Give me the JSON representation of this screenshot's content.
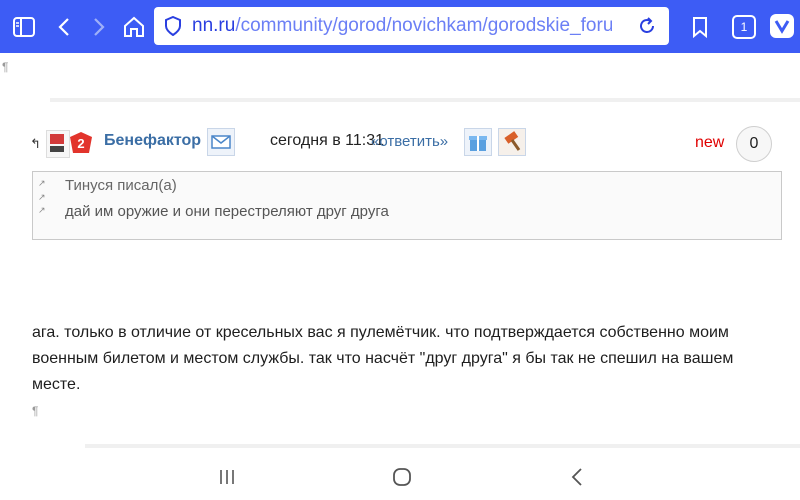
{
  "browser": {
    "url_domain": "nn.ru",
    "url_path": "/community/gorod/novichkam/gorodskie_foru",
    "tab_count": "1",
    "icons": [
      "sidebar-icon",
      "back-icon",
      "forward-icon",
      "home-icon",
      "shield-icon",
      "reload-icon",
      "bookmark-icon",
      "tabs-icon",
      "vivaldi-icon"
    ],
    "accent_color": "#3d5cf5"
  },
  "page": {
    "paragraph_mark": "¶"
  },
  "post": {
    "author": "Бенефактор",
    "timestamp": "сегодня в 11:31",
    "reply_label": "«ответить»",
    "new_label": "new",
    "reply_count": "0",
    "badge_number": "2",
    "quote": {
      "author_line": "Тинуся писал(а)",
      "text": "дай им оружие и они перестреляют друг друга"
    },
    "body": "ага. только в отличие от кресельных вас я пулемётчик. что подтверждается собственно моим военным билетом и местом службы. так что насчёт \"друг друга\" я бы так не спешил на вашем месте."
  },
  "navbar": {
    "icons": [
      "recent-apps-icon",
      "home-nav-icon",
      "back-nav-icon"
    ]
  }
}
